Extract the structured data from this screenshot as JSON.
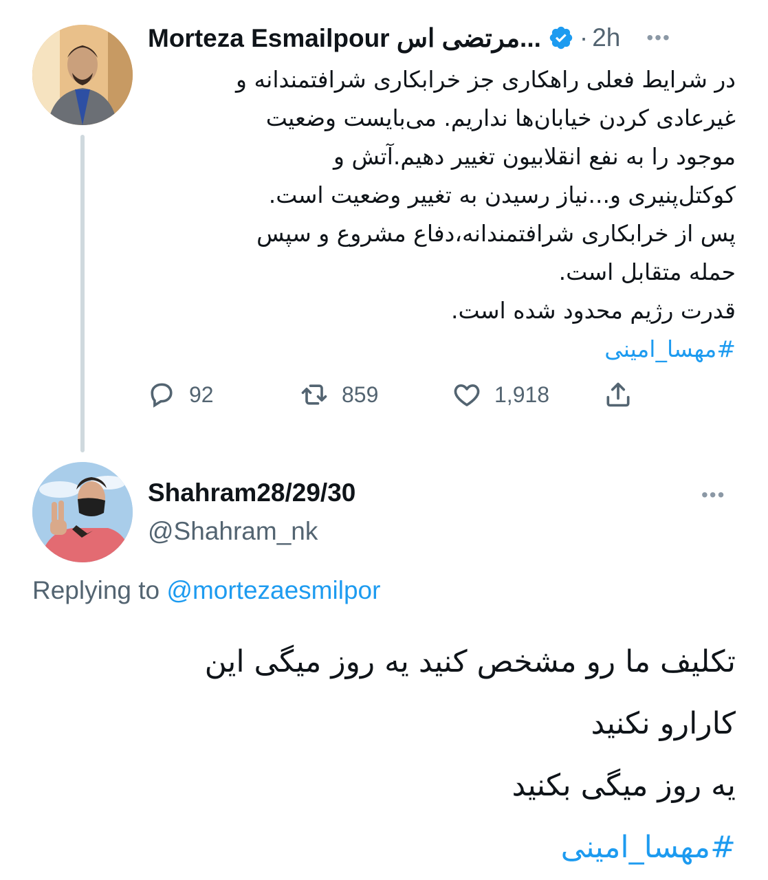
{
  "main_tweet": {
    "display_name": "Morteza Esmailpour مرتضی اس...",
    "verified": true,
    "separator": "·",
    "time": "2h",
    "more": "•••",
    "text_lines": [
      "در شرایط فعلی راهکاری جز خرابکاری شرافتمندانه و",
      "غیرعادی کردن خیابان‌ها نداریم. می‌بایست وضعیت",
      "موجود را به نفع انقلابیون تغییر دهیم.آتش و",
      "کوکتل‌پنیری و...نیاز رسیدن به تغییر وضعیت است.",
      "پس از خرابکاری شرافتمندانه،دفاع مشروع و سپس",
      "حمله متقابل است.",
      "قدرت رژیم محدود شده است."
    ],
    "hashtag": "#مهسا_امینی",
    "replies": "92",
    "retweets": "859",
    "likes": "1,918"
  },
  "reply_tweet": {
    "display_name": "Shahram28/29/30",
    "handle": "@Shahram_nk",
    "more": "•••",
    "replying_label": "Replying to",
    "replying_to": "@mortezaesmilpor",
    "text_lines": [
      "تکلیف ما رو مشخص کنید یه روز میگی این",
      "کارارو نکنید",
      "یه روز میگی بکنید"
    ],
    "hashtag": "#مهسا_امینی"
  },
  "colors": {
    "accent": "#1d9bf0",
    "secondary_text": "#536471",
    "thread_line": "#cfd9de"
  },
  "icons": {
    "reply": "speech-bubble-icon",
    "retweet": "retweet-icon",
    "like": "heart-icon",
    "share": "share-icon",
    "verified": "verified-badge-icon"
  }
}
